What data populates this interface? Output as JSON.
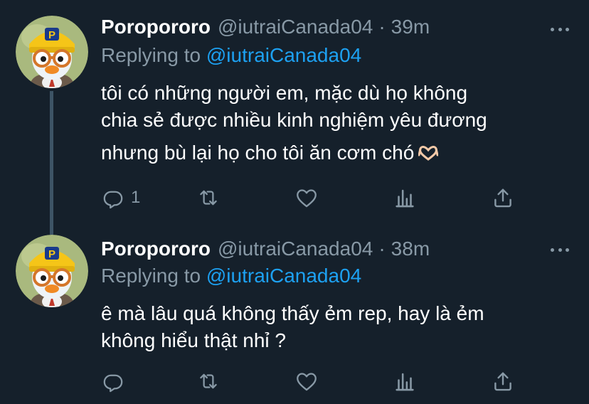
{
  "tweets": [
    {
      "display_name": "Poropororo",
      "handle": "@iutraiCanada04",
      "separator": "·",
      "time": "39m",
      "replying_label": "Replying to",
      "replying_to": "@iutraiCanada04",
      "lines": [
        "tôi có những người em, mặc dù họ không",
        "chia sẻ được nhiều kinh nghiệm yêu đương",
        "nhưng bù lại họ cho tôi ăn cơm chó"
      ],
      "emoji": "heart-hands-emoji",
      "reply_count": "1",
      "retweet_count": "",
      "like_count": ""
    },
    {
      "display_name": "Poropororo",
      "handle": "@iutraiCanada04",
      "separator": "·",
      "time": "38m",
      "replying_label": "Replying to",
      "replying_to": "@iutraiCanada04",
      "lines": [
        "ê mà lâu quá không thấy ẻm rep, hay là ẻm",
        "không hiểu thật nhỉ ?"
      ],
      "reply_count": "",
      "retweet_count": "",
      "like_count": ""
    }
  ],
  "icons": {
    "reply": "reply-icon",
    "retweet": "retweet-icon",
    "like": "heart-icon",
    "analytics": "analytics-icon",
    "share": "share-icon",
    "more": "more-icon"
  },
  "colors": {
    "background": "#15202b",
    "secondary_text": "#8899a6",
    "accent": "#1da1f2",
    "thread_line": "#3d5466"
  }
}
